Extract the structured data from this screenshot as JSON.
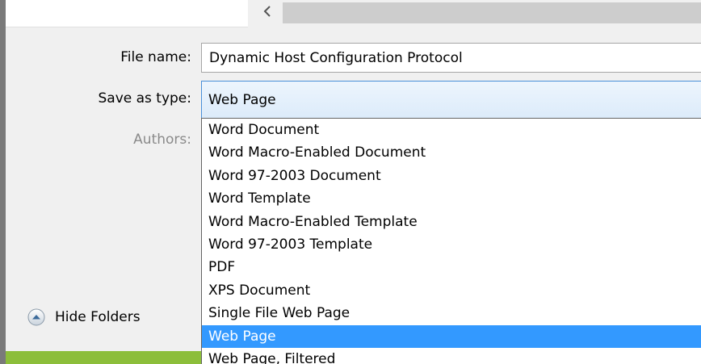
{
  "fields": {
    "file_name_label": "File name:",
    "file_name_value": "Dynamic Host Configuration Protocol",
    "save_as_type_label": "Save as type:",
    "save_as_type_value": "Web Page",
    "authors_label": "Authors:"
  },
  "dropdown": {
    "options": [
      "Word Document",
      "Word Macro-Enabled Document",
      "Word 97-2003 Document",
      "Word Template",
      "Word Macro-Enabled Template",
      "Word 97-2003 Template",
      "PDF",
      "XPS Document",
      "Single File Web Page",
      "Web Page",
      "Web Page, Filtered"
    ],
    "selected_index": 9
  },
  "hide_folders": {
    "label": "Hide Folders",
    "icon": "chevron-up-circle-icon"
  },
  "colors": {
    "selection": "#3399ff",
    "accent_green": "#8cbe3a"
  }
}
